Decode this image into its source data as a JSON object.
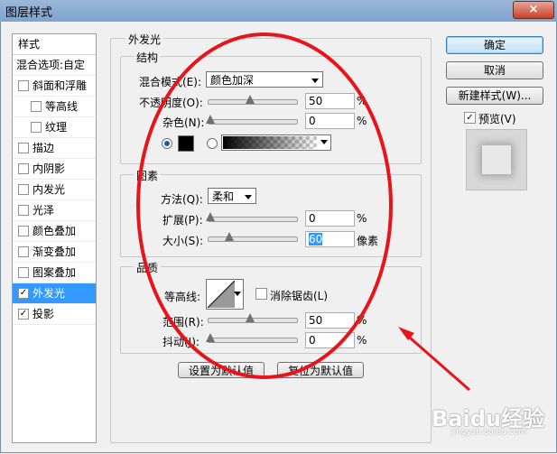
{
  "window": {
    "title": "图层样式",
    "close": "×"
  },
  "styles": {
    "header": "样式",
    "blend_options": "混合选项:自定",
    "items": [
      {
        "label": "斜面和浮雕",
        "checked": false,
        "indent": false
      },
      {
        "label": "等高线",
        "checked": false,
        "indent": true
      },
      {
        "label": "纹理",
        "checked": false,
        "indent": true
      },
      {
        "label": "描边",
        "checked": false,
        "indent": false
      },
      {
        "label": "内阴影",
        "checked": false,
        "indent": false
      },
      {
        "label": "内发光",
        "checked": false,
        "indent": false
      },
      {
        "label": "光泽",
        "checked": false,
        "indent": false
      },
      {
        "label": "颜色叠加",
        "checked": false,
        "indent": false
      },
      {
        "label": "渐变叠加",
        "checked": false,
        "indent": false
      },
      {
        "label": "图案叠加",
        "checked": false,
        "indent": false
      },
      {
        "label": "外发光",
        "checked": true,
        "indent": false,
        "selected": true
      },
      {
        "label": "投影",
        "checked": true,
        "indent": false
      }
    ]
  },
  "outer_glow": {
    "title": "外发光",
    "structure": {
      "title": "结构",
      "blend_mode_label": "混合模式(E):",
      "blend_mode_value": "颜色加深",
      "opacity_label": "不透明度(O):",
      "opacity_value": "50",
      "opacity_pct": 50,
      "noise_label": "杂色(N):",
      "noise_value": "0",
      "noise_pct": 0,
      "percent": "%"
    },
    "elements": {
      "title": "图素",
      "technique_label": "方法(Q):",
      "technique_value": "柔和",
      "spread_label": "扩展(P):",
      "spread_value": "0",
      "spread_pct": 0,
      "size_label": "大小(S):",
      "size_value": "60",
      "size_fraction": 0.24,
      "percent": "%",
      "px": "像素"
    },
    "quality": {
      "title": "品质",
      "contour_label": "等高线:",
      "antialias_label": "消除锯齿(L)",
      "antialias_checked": false,
      "range_label": "范围(R):",
      "range_value": "50",
      "range_pct": 50,
      "jitter_label": "抖动(J):",
      "jitter_value": "0",
      "jitter_pct": 0,
      "percent": "%"
    },
    "make_default": "设置为默认值",
    "reset_default": "复位为默认值"
  },
  "buttons": {
    "ok": "确定",
    "cancel": "取消",
    "new_style": "新建样式(W)...",
    "preview": "预览(V)",
    "preview_checked": true
  },
  "colors": {
    "annotation": "#e8141c",
    "glow_color": "#000000",
    "selection": "#3399ff"
  },
  "watermark": {
    "text": "Baidu经验",
    "sub": "jingyan.baidu.com"
  }
}
